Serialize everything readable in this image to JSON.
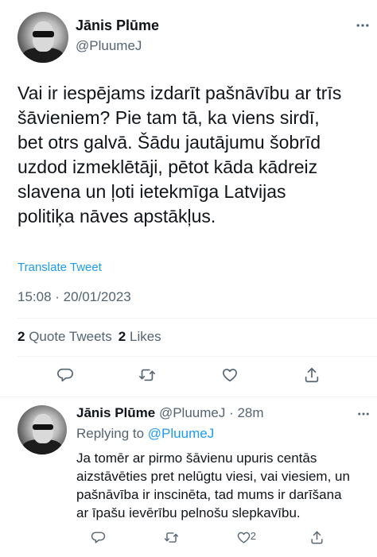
{
  "main_tweet": {
    "author_name": "Jānis Plūme",
    "author_handle": "@PluumeJ",
    "more_icon": "more-horizontal-icon",
    "text": "Vai ir iespējams izdarīt pašnāvību ar trīs\nšāvieniem? Pie tam tā, ka viens sirdī,\nbet otrs galvā. Šādu jautājumu šobrīd\nuzdod izmeklētāji, pētot kāda kādreiz\nslavena un ļoti ietekmīga Latvijas\npolitiķa nāves apstākļus.",
    "translate_label": "Translate Tweet",
    "timestamp": "15:08 · 20/01/2023",
    "quote_count": "2",
    "quote_label": "Quote Tweets",
    "like_count": "2",
    "like_label": "Likes",
    "actions": [
      "reply-icon",
      "retweet-icon",
      "like-icon",
      "share-icon"
    ]
  },
  "reply_tweet": {
    "author_name": "Jānis Plūme",
    "author_handle": "@PluumeJ",
    "time_ago": "· 28m",
    "replying_prefix": "Replying to",
    "replying_to": "@PluumeJ",
    "text": "Ja tomēr ar pirmo šāvienu upuris centās\naizstāvēties pret nelūgtu viesi, vai viesiem, un\npašnāvība ir inscinēta, tad mums ir darīšana\nar īpašu ievērību pelnošu slepkavību.",
    "like_count": "2",
    "actions": [
      "reply-icon",
      "retweet-icon",
      "like-icon",
      "share-icon"
    ]
  },
  "colors": {
    "text": "#0f1419",
    "secondary": "#536471",
    "link": "#1d9bf0",
    "divider": "#eff3f4"
  }
}
